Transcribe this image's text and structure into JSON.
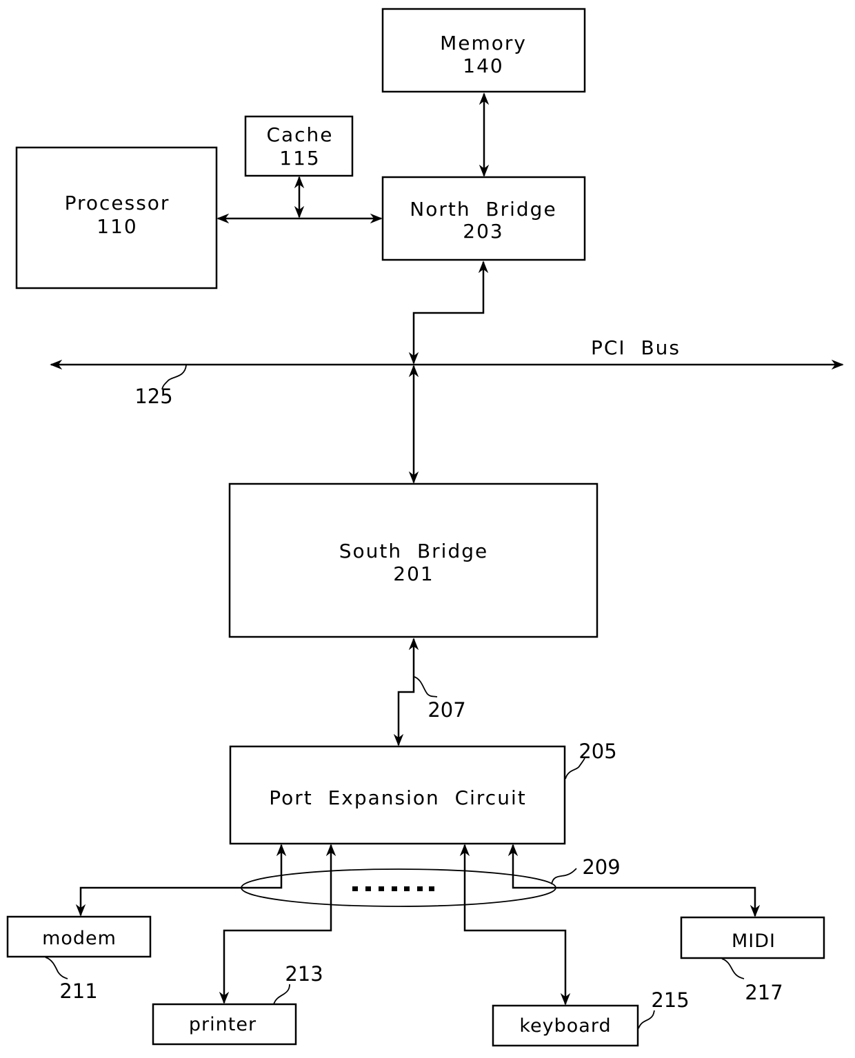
{
  "diagram": {
    "type": "block-diagram",
    "blocks": {
      "memory": {
        "name": "Memory",
        "ref": "140"
      },
      "cache": {
        "name": "Cache",
        "ref": "115"
      },
      "processor": {
        "name": "Processor",
        "ref": "110"
      },
      "north_bridge": {
        "name": "North  Bridge",
        "ref": "203"
      },
      "south_bridge": {
        "name": "South  Bridge",
        "ref": "201"
      },
      "port_expansion": {
        "name": "Port  Expansion  Circuit",
        "ref": "205"
      },
      "modem": {
        "name": "modem",
        "ref": "211"
      },
      "printer": {
        "name": "printer",
        "ref": "213"
      },
      "keyboard": {
        "name": "keyboard",
        "ref": "215"
      },
      "midi": {
        "name": "MIDI",
        "ref": "217"
      }
    },
    "bus": {
      "name": "PCI  Bus",
      "ref": "125"
    },
    "link_refs": {
      "south_to_port": "207",
      "port_bundle": "209"
    },
    "ellipsis": "......."
  }
}
